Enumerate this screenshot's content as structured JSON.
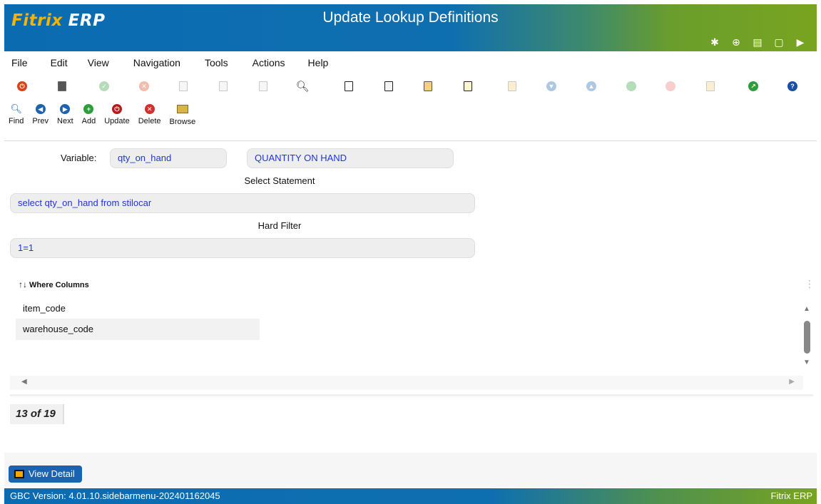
{
  "header": {
    "logo_main": "Fitrix",
    "logo_suffix": "ERP",
    "title": "Update Lookup Definitions",
    "icons": [
      "gear-icon",
      "settings-cog-icon",
      "document-icon",
      "new-document-icon",
      "play-icon"
    ]
  },
  "menu": [
    "File",
    "Edit",
    "View",
    "Navigation",
    "Tools",
    "Actions",
    "Help"
  ],
  "toolbar2": [
    {
      "label": "Find",
      "icon": "search-icon",
      "color": "#1b63b0"
    },
    {
      "label": "Prev",
      "icon": "arrow-left-icon",
      "color": "#1b63b0"
    },
    {
      "label": "Next",
      "icon": "arrow-right-icon",
      "color": "#1b63b0"
    },
    {
      "label": "Add",
      "icon": "plus-icon",
      "color": "#2e9e3a"
    },
    {
      "label": "Update",
      "icon": "power-icon",
      "color": "#b71c1c"
    },
    {
      "label": "Delete",
      "icon": "x-icon",
      "color": "#d32f2f"
    },
    {
      "label": "Browse",
      "icon": "folder-icon",
      "color": "#c9a227"
    }
  ],
  "form": {
    "variable_label": "Variable:",
    "variable_value": "qty_on_hand",
    "variable_desc": "QUANTITY ON HAND",
    "select_label": "Select Statement",
    "select_value": "select qty_on_hand from stilocar",
    "filter_label": "Hard Filter",
    "filter_value": "1=1"
  },
  "table": {
    "header": "Where Columns",
    "rows": [
      "item_code",
      "warehouse_code"
    ]
  },
  "record_count": "13 of 19",
  "view_detail_label": "View Detail",
  "status": {
    "version": "GBC Version: 4.01.10.sidebarmenu-202401162045",
    "app": "Fitrix ERP"
  },
  "colors": {
    "brand_blue": "#0b6bb1",
    "brand_green": "#78a41f",
    "field_text": "#1f35d6"
  }
}
